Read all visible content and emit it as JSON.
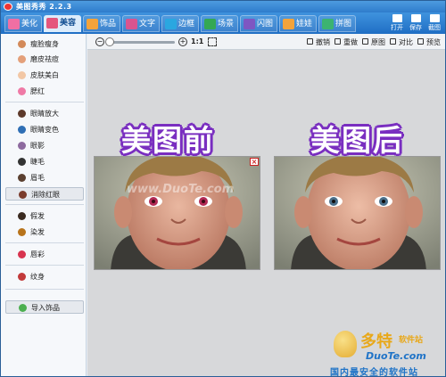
{
  "app": {
    "title": "美图秀秀 2.2.3"
  },
  "tabs": [
    {
      "label": "美化",
      "active": false,
      "color": "#f06fa3"
    },
    {
      "label": "美容",
      "active": true,
      "color": "#e5567c"
    },
    {
      "label": "饰品",
      "active": false,
      "color": "#f3a33b"
    },
    {
      "label": "文字",
      "active": false,
      "color": "#d9548f"
    },
    {
      "label": "边框",
      "active": false,
      "color": "#2aa7e0"
    },
    {
      "label": "场景",
      "active": false,
      "color": "#34a853"
    },
    {
      "label": "闪图",
      "active": false,
      "color": "#7e57c2"
    },
    {
      "label": "娃娃",
      "active": false,
      "color": "#f3a33b"
    },
    {
      "label": "拼图",
      "active": false,
      "color": "#3cb371"
    }
  ],
  "top_actions": [
    {
      "label": "打开",
      "icon": "folder-icon"
    },
    {
      "label": "保存",
      "icon": "save-icon"
    },
    {
      "label": "截图",
      "icon": "scissors-icon"
    }
  ],
  "sidebar": {
    "items": [
      {
        "label": "瘦脸瘦身",
        "icon": "face-slim-icon",
        "color": "#d38a5a"
      },
      {
        "label": "磨皮祛痘",
        "icon": "skin-smooth-icon",
        "color": "#e4a07a"
      },
      {
        "label": "皮肤美白",
        "icon": "whitening-icon",
        "color": "#f2c7a5"
      },
      {
        "label": "腮红",
        "icon": "blush-icon",
        "color": "#ef7aa6"
      },
      {
        "label": "眼睛放大",
        "icon": "eye-enlarge-icon",
        "color": "#5d3a2b"
      },
      {
        "label": "眼睛变色",
        "icon": "eye-color-icon",
        "color": "#2f6fb5"
      },
      {
        "label": "眼影",
        "icon": "eyeshadow-icon",
        "color": "#8d6a9f"
      },
      {
        "label": "睫毛",
        "icon": "eyelash-icon",
        "color": "#333333"
      },
      {
        "label": "眉毛",
        "icon": "eyebrow-icon",
        "color": "#5b4030"
      },
      {
        "label": "消除红眼",
        "icon": "red-eye-icon",
        "color": "#7a3b2b",
        "selected": true
      },
      {
        "label": "假发",
        "icon": "wig-icon",
        "color": "#3a2a20"
      },
      {
        "label": "染发",
        "icon": "hair-dye-icon",
        "color": "#b8741b"
      },
      {
        "label": "唇彩",
        "icon": "lip-gloss-icon",
        "color": "#d8344f"
      },
      {
        "label": "纹身",
        "icon": "tattoo-icon",
        "color": "#c23a3a"
      },
      {
        "label": "导入饰品",
        "icon": "import-accessory-icon",
        "color": "#4caf50"
      }
    ]
  },
  "canvas_toolbar": {
    "ratio": "1:1",
    "zoom_slider_level": 0.1,
    "actions": [
      {
        "label": "撤销",
        "icon": "undo-icon"
      },
      {
        "label": "重做",
        "icon": "redo-icon"
      },
      {
        "label": "原图",
        "icon": "original-icon"
      },
      {
        "label": "对比",
        "icon": "compare-icon"
      },
      {
        "label": "预览",
        "icon": "preview-icon"
      }
    ]
  },
  "canvas": {
    "before_caption": "美图前",
    "after_caption": "美图后",
    "before_watermark": "www.DuoTe.com"
  },
  "watermark": {
    "brand": "多特",
    "brand_suffix": "软件站",
    "url": "DuoTe.com",
    "tagline": "国内最安全的软件站"
  }
}
